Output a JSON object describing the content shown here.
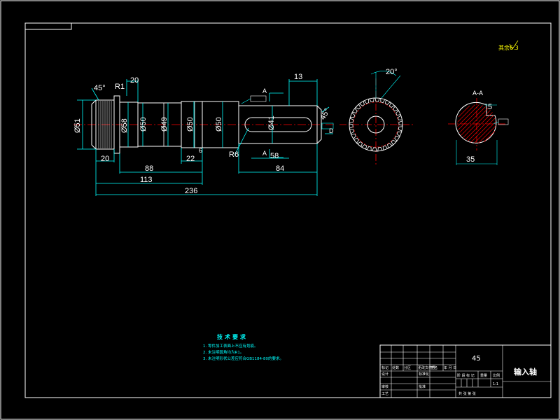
{
  "colors": {
    "background": "#000000",
    "frame": "#ffffff",
    "outline": "#ffffff",
    "dimension": "#00ffff",
    "centerline": "#ff0000",
    "hatch": "#ff0000",
    "text": "#ffffff",
    "note_text": "#00ffff",
    "part_name": "#ffff00"
  },
  "shaft_dimensions": {
    "chamfer_angle": "45°",
    "fillet_radius": "R1",
    "top_length": "20",
    "diameters": [
      "Ø51",
      "Ø58",
      "Ø50",
      "Ø49",
      "Ø50",
      "Ø50",
      "Ø41"
    ],
    "right_top_length": "13",
    "section_marker": "A",
    "slope": "45°",
    "right_d": "D",
    "keyway_fillet": "R6",
    "small_6": "6",
    "bottom_lengths": [
      "20",
      "22",
      "58",
      "88",
      "84",
      "113",
      "236"
    ]
  },
  "gear_view": {
    "angle": "20°"
  },
  "section_view": {
    "label_a": "A-A",
    "keyway_depth": "5",
    "width": "35"
  },
  "roughness_label": "其余6.3",
  "technical_requirements": {
    "title": "技术要求",
    "items": [
      "1. 零件加工表面上不应有划痕。",
      "2. 未注明圆角均为R1。",
      "3. 未注明形状公差应符合GB1184-80的要求。"
    ]
  },
  "title_block": {
    "material": "45",
    "part_name": "输入轴",
    "header_row": [
      "标记",
      "处数",
      "分区",
      "更改文件号",
      "签名",
      "年 月 日"
    ],
    "rows": [
      "设计",
      "审核",
      "工艺"
    ],
    "std_labels": [
      "标准化",
      "批准"
    ],
    "stage_labels": [
      "阶 段 标 记",
      "重量",
      "比例"
    ],
    "scale": "1:1",
    "sheet_row": "共  张  第  张"
  }
}
